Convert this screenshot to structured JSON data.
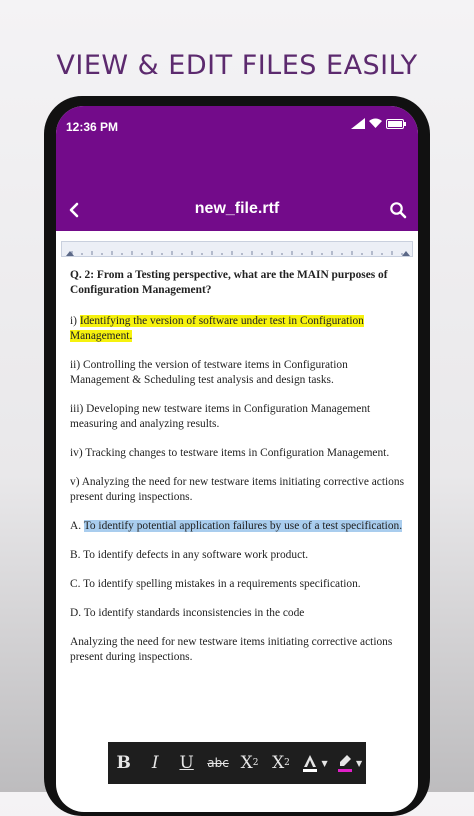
{
  "promo": {
    "title": "VIEW & EDIT FILES EASILY"
  },
  "status_bar": {
    "time": "12:36 PM"
  },
  "app_bar": {
    "file_name": "new_file.rtf"
  },
  "document": {
    "question": "Q. 2: From a Testing perspective, what are the MAIN purposes of Configuration Management?",
    "item_i_prefix": "i) ",
    "item_i_highlight": "Identifying the version of software under test in Configuration Management.",
    "item_ii": "ii) Controlling the version of testware items in Configuration Management & Scheduling test analysis and design tasks.",
    "item_iii": "iii) Developing new testware items in Configuration Management measuring and analyzing results.",
    "item_iv": "iv) Tracking changes to testware items in Configuration Management.",
    "item_v": "v) Analyzing the need for new testware items initiating corrective actions present during inspections.",
    "option_a_prefix": "A. ",
    "option_a_highlight": "To identify potential application failures by use of a test specification.",
    "option_b": "B. To identify defects in any software work product.",
    "option_c": "C. To identify spelling mistakes in a requirements specification.",
    "option_d": "D. To identify standards inconsistencies in the code",
    "closing": "Analyzing the need for new testware items initiating corrective actions present during inspections."
  },
  "toolbar": {
    "bold": "B",
    "italic": "I",
    "underline": "U",
    "strikethrough": "abc",
    "subscript_base": "X",
    "subscript_mark": "2",
    "superscript_base": "X",
    "superscript_mark": "2",
    "text_color_icon": "text-color-icon",
    "highlight_icon": "highlighter-icon"
  },
  "colors": {
    "app_bar": "#730b8a",
    "promo_title": "#5c2a6e",
    "highlight_yellow": "#f6f20e",
    "highlight_blue": "#a9cdee",
    "toolbar_bg": "#1e1e1e",
    "highlighter_color": "#e020c8"
  }
}
